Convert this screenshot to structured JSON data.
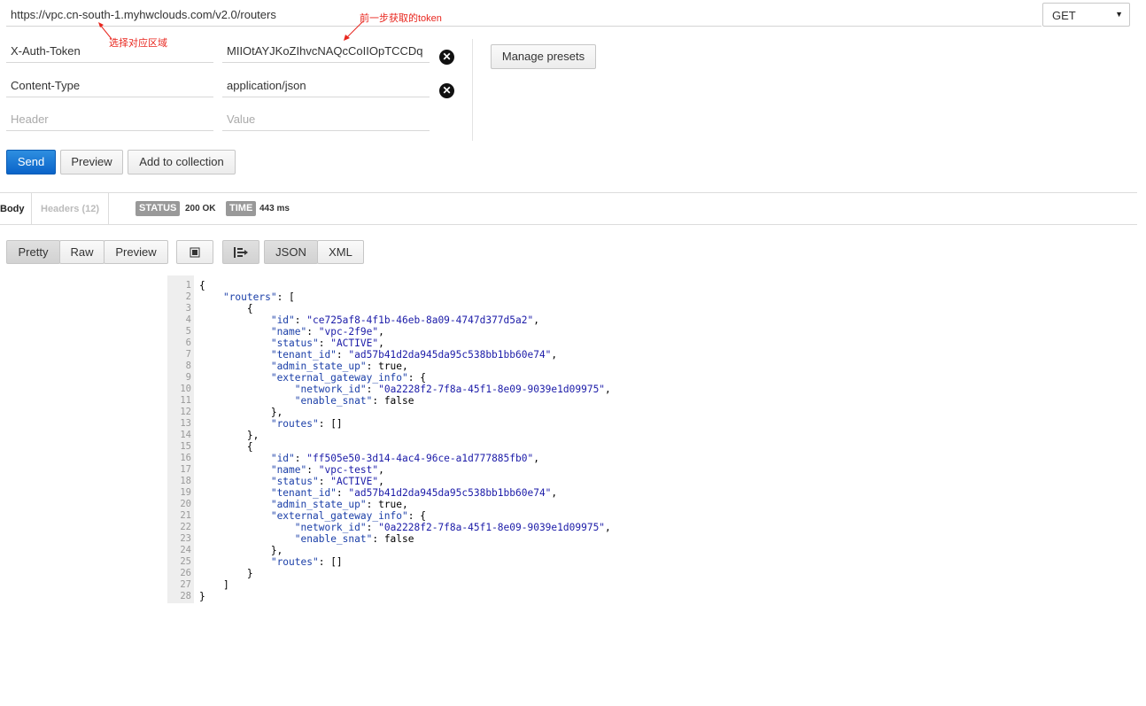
{
  "request": {
    "url": "https://vpc.cn-south-1.myhwclouds.com/v2.0/routers",
    "method": "GET"
  },
  "headers": [
    {
      "key": "X-Auth-Token",
      "value": "MIIOtAYJKoZIhvcNAQcCoIIOpTCCDq"
    },
    {
      "key": "Content-Type",
      "value": "application/json"
    }
  ],
  "header_placeholders": {
    "key": "Header",
    "value": "Value"
  },
  "presets": {
    "manage_label": "Manage presets"
  },
  "actions": {
    "send_label": "Send",
    "preview_label": "Preview",
    "add_to_collection_label": "Add to collection"
  },
  "response": {
    "tabs": {
      "body": "Body",
      "headers": "Headers (12)"
    },
    "status_label": "STATUS",
    "status_value": "200 OK",
    "time_label": "TIME",
    "time_value": "443 ms",
    "view_modes": [
      "Pretty",
      "Raw",
      "Preview"
    ],
    "formats": [
      "JSON",
      "XML"
    ]
  },
  "annotations": {
    "region_note": "选择对应区域",
    "token_note": "前一步获取的token"
  },
  "colors": {
    "primary_button": "#0a63c9",
    "badge_bg": "#999999",
    "annotation": "#e8261e",
    "json_key": "#1b3fa8",
    "json_string": "#1b1ba8"
  },
  "body_lines": [
    {
      "n": "1",
      "segs": [
        {
          "t": "{",
          "c": "lit"
        }
      ]
    },
    {
      "n": "2",
      "segs": [
        {
          "t": "    ",
          "c": "lit"
        },
        {
          "t": "\"routers\"",
          "c": "k"
        },
        {
          "t": ": [",
          "c": "lit"
        }
      ]
    },
    {
      "n": "3",
      "segs": [
        {
          "t": "        {",
          "c": "lit"
        }
      ]
    },
    {
      "n": "4",
      "segs": [
        {
          "t": "            ",
          "c": "lit"
        },
        {
          "t": "\"id\"",
          "c": "k"
        },
        {
          "t": ": ",
          "c": "lit"
        },
        {
          "t": "\"ce725af8-4f1b-46eb-8a09-4747d377d5a2\"",
          "c": "s"
        },
        {
          "t": ",",
          "c": "lit"
        }
      ]
    },
    {
      "n": "5",
      "segs": [
        {
          "t": "            ",
          "c": "lit"
        },
        {
          "t": "\"name\"",
          "c": "k"
        },
        {
          "t": ": ",
          "c": "lit"
        },
        {
          "t": "\"vpc-2f9e\"",
          "c": "s"
        },
        {
          "t": ",",
          "c": "lit"
        }
      ]
    },
    {
      "n": "6",
      "segs": [
        {
          "t": "            ",
          "c": "lit"
        },
        {
          "t": "\"status\"",
          "c": "k"
        },
        {
          "t": ": ",
          "c": "lit"
        },
        {
          "t": "\"ACTIVE\"",
          "c": "s"
        },
        {
          "t": ",",
          "c": "lit"
        }
      ]
    },
    {
      "n": "7",
      "segs": [
        {
          "t": "            ",
          "c": "lit"
        },
        {
          "t": "\"tenant_id\"",
          "c": "k"
        },
        {
          "t": ": ",
          "c": "lit"
        },
        {
          "t": "\"ad57b41d2da945da95c538bb1bb60e74\"",
          "c": "s"
        },
        {
          "t": ",",
          "c": "lit"
        }
      ]
    },
    {
      "n": "8",
      "segs": [
        {
          "t": "            ",
          "c": "lit"
        },
        {
          "t": "\"admin_state_up\"",
          "c": "k"
        },
        {
          "t": ": true,",
          "c": "lit"
        }
      ]
    },
    {
      "n": "9",
      "segs": [
        {
          "t": "            ",
          "c": "lit"
        },
        {
          "t": "\"external_gateway_info\"",
          "c": "k"
        },
        {
          "t": ": {",
          "c": "lit"
        }
      ]
    },
    {
      "n": "10",
      "segs": [
        {
          "t": "                ",
          "c": "lit"
        },
        {
          "t": "\"network_id\"",
          "c": "k"
        },
        {
          "t": ": ",
          "c": "lit"
        },
        {
          "t": "\"0a2228f2-7f8a-45f1-8e09-9039e1d09975\"",
          "c": "s"
        },
        {
          "t": ",",
          "c": "lit"
        }
      ]
    },
    {
      "n": "11",
      "segs": [
        {
          "t": "                ",
          "c": "lit"
        },
        {
          "t": "\"enable_snat\"",
          "c": "k"
        },
        {
          "t": ": false",
          "c": "lit"
        }
      ]
    },
    {
      "n": "12",
      "segs": [
        {
          "t": "            },",
          "c": "lit"
        }
      ]
    },
    {
      "n": "13",
      "segs": [
        {
          "t": "            ",
          "c": "lit"
        },
        {
          "t": "\"routes\"",
          "c": "k"
        },
        {
          "t": ": []",
          "c": "lit"
        }
      ]
    },
    {
      "n": "14",
      "segs": [
        {
          "t": "        },",
          "c": "lit"
        }
      ]
    },
    {
      "n": "15",
      "segs": [
        {
          "t": "        {",
          "c": "lit"
        }
      ]
    },
    {
      "n": "16",
      "segs": [
        {
          "t": "            ",
          "c": "lit"
        },
        {
          "t": "\"id\"",
          "c": "k"
        },
        {
          "t": ": ",
          "c": "lit"
        },
        {
          "t": "\"ff505e50-3d14-4ac4-96ce-a1d777885fb0\"",
          "c": "s"
        },
        {
          "t": ",",
          "c": "lit"
        }
      ]
    },
    {
      "n": "17",
      "segs": [
        {
          "t": "            ",
          "c": "lit"
        },
        {
          "t": "\"name\"",
          "c": "k"
        },
        {
          "t": ": ",
          "c": "lit"
        },
        {
          "t": "\"vpc-test\"",
          "c": "s"
        },
        {
          "t": ",",
          "c": "lit"
        }
      ]
    },
    {
      "n": "18",
      "segs": [
        {
          "t": "            ",
          "c": "lit"
        },
        {
          "t": "\"status\"",
          "c": "k"
        },
        {
          "t": ": ",
          "c": "lit"
        },
        {
          "t": "\"ACTIVE\"",
          "c": "s"
        },
        {
          "t": ",",
          "c": "lit"
        }
      ]
    },
    {
      "n": "19",
      "segs": [
        {
          "t": "            ",
          "c": "lit"
        },
        {
          "t": "\"tenant_id\"",
          "c": "k"
        },
        {
          "t": ": ",
          "c": "lit"
        },
        {
          "t": "\"ad57b41d2da945da95c538bb1bb60e74\"",
          "c": "s"
        },
        {
          "t": ",",
          "c": "lit"
        }
      ]
    },
    {
      "n": "20",
      "segs": [
        {
          "t": "            ",
          "c": "lit"
        },
        {
          "t": "\"admin_state_up\"",
          "c": "k"
        },
        {
          "t": ": true,",
          "c": "lit"
        }
      ]
    },
    {
      "n": "21",
      "segs": [
        {
          "t": "            ",
          "c": "lit"
        },
        {
          "t": "\"external_gateway_info\"",
          "c": "k"
        },
        {
          "t": ": {",
          "c": "lit"
        }
      ]
    },
    {
      "n": "22",
      "segs": [
        {
          "t": "                ",
          "c": "lit"
        },
        {
          "t": "\"network_id\"",
          "c": "k"
        },
        {
          "t": ": ",
          "c": "lit"
        },
        {
          "t": "\"0a2228f2-7f8a-45f1-8e09-9039e1d09975\"",
          "c": "s"
        },
        {
          "t": ",",
          "c": "lit"
        }
      ]
    },
    {
      "n": "23",
      "segs": [
        {
          "t": "                ",
          "c": "lit"
        },
        {
          "t": "\"enable_snat\"",
          "c": "k"
        },
        {
          "t": ": false",
          "c": "lit"
        }
      ]
    },
    {
      "n": "24",
      "segs": [
        {
          "t": "            },",
          "c": "lit"
        }
      ]
    },
    {
      "n": "25",
      "segs": [
        {
          "t": "            ",
          "c": "lit"
        },
        {
          "t": "\"routes\"",
          "c": "k"
        },
        {
          "t": ": []",
          "c": "lit"
        }
      ]
    },
    {
      "n": "26",
      "segs": [
        {
          "t": "        }",
          "c": "lit"
        }
      ]
    },
    {
      "n": "27",
      "segs": [
        {
          "t": "    ]",
          "c": "lit"
        }
      ]
    },
    {
      "n": "28",
      "segs": [
        {
          "t": "}",
          "c": "lit"
        }
      ]
    }
  ]
}
